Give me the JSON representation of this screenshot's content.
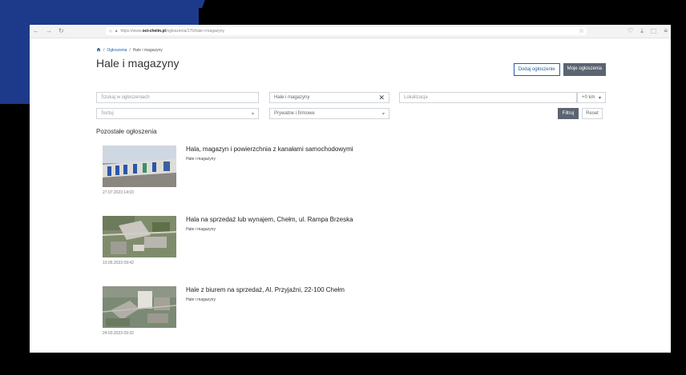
{
  "browser": {
    "url_prefix": "https://www.",
    "url_domain": "ooi-chelm.pl",
    "url_path": "/ogloszenia/175/hale-i-magazyny"
  },
  "breadcrumb": {
    "link": "Ogłoszenia",
    "separator1": "/",
    "separator2": "/",
    "current": "Hale i magazyny"
  },
  "page_title": "Hale i magazyny",
  "header_buttons": {
    "add": "Dodaj ogłoszenie",
    "mine": "Moje ogłoszenia"
  },
  "filters": {
    "search_placeholder": "Szukaj w ogłoszeniach",
    "category_value": "Hale i magazyny",
    "location_placeholder": "Lokalizacja",
    "radius": "+0 km",
    "sort_placeholder": "Sortuj",
    "type_value": "Prywatne i firmowe",
    "filter_button": "Filtruj",
    "reset_button": "Reset"
  },
  "section_title": "Pozostałe ogłoszenia",
  "listings": [
    {
      "title": "Hala, magazyn i powierzchnia z kanałami samochodowymi",
      "category": "Hale i magazyny",
      "date": "27.07.2023 14:03"
    },
    {
      "title": "Hala na sprzedaż lub wynajem, Chełm, ul. Rampa Brzeska",
      "category": "Hale i magazyny",
      "date": "10.05.2023 09:42"
    },
    {
      "title": "Hale z biurem na sprzedaż, Al. Przyjaźni, 22-100 Chełm",
      "category": "Hale i magazyny",
      "date": "24.03.2023 09:32"
    }
  ],
  "icons": {
    "home": "home-icon",
    "clear": "close-icon",
    "dropdown": "chevron-down-icon"
  },
  "colors": {
    "accent": "#1f5fa8",
    "dark_button": "#5b6470",
    "frame_blue": "#1d3a8a"
  }
}
